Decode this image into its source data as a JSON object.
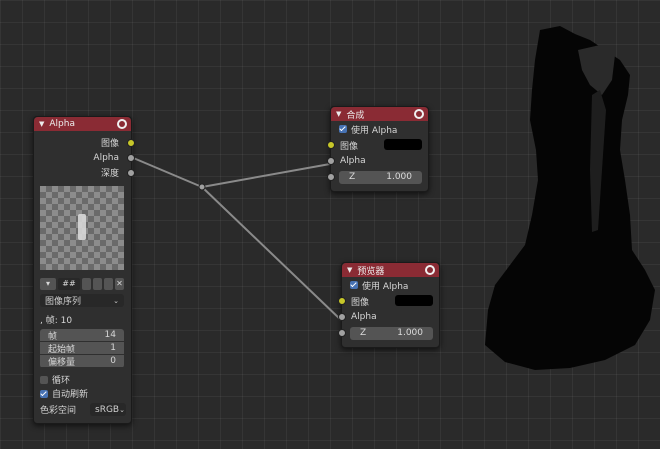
{
  "image_node": {
    "title": "Alpha",
    "outputs": [
      "图像",
      "Alpha",
      "深度"
    ],
    "toolbar_text": "##",
    "source": "图像序列",
    "frames_text": ", 帧: 10",
    "params": [
      {
        "label": "帧",
        "value": "14"
      },
      {
        "label": "起始帧",
        "value": "1"
      },
      {
        "label": "偏移量",
        "value": "0"
      }
    ],
    "cyclic_label": "循环",
    "auto_refresh_label": "自动刷新",
    "color_space_label": "色彩空间",
    "color_space_value": "sRGB"
  },
  "composite_node": {
    "title": "合成",
    "use_alpha_label": "使用 Alpha",
    "inputs": [
      "图像",
      "Alpha"
    ],
    "z_label": "Z",
    "z_value": "1.000"
  },
  "viewer_node": {
    "title": "预览器",
    "use_alpha_label": "使用 Alpha",
    "inputs": [
      "图像",
      "Alpha"
    ],
    "z_label": "Z",
    "z_value": "1.000"
  },
  "colors": {
    "header": "#8a2b34",
    "socket_image": "#c7c729",
    "socket_value": "#a1a1a1",
    "checkbox_on": "#4772b3"
  }
}
